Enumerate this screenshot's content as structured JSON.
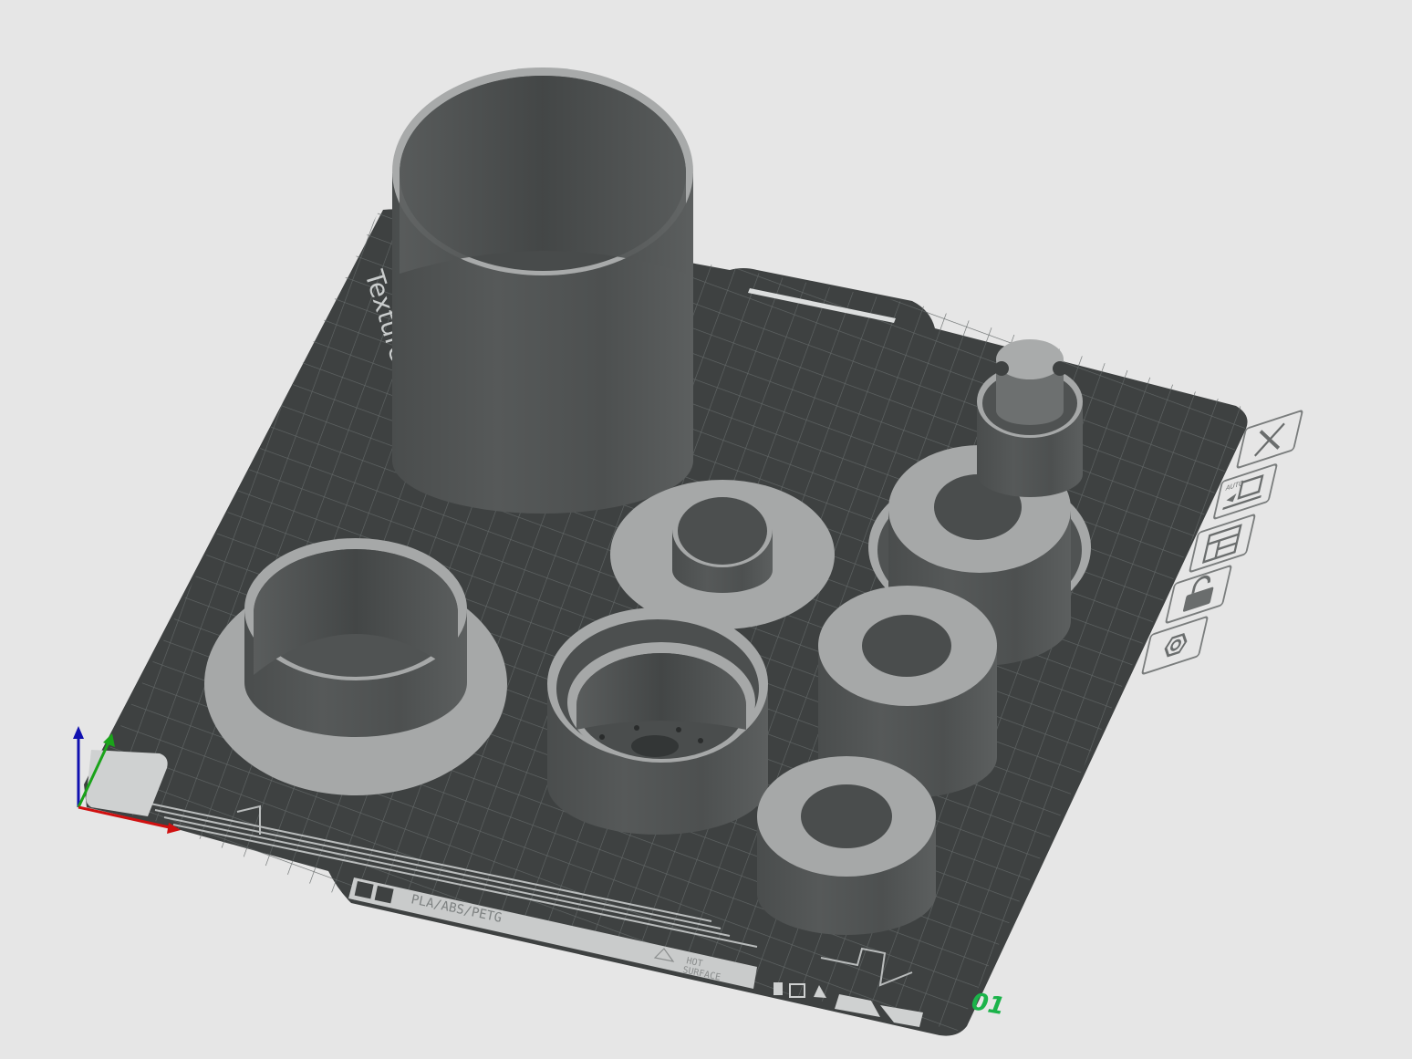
{
  "plate": {
    "name_label": "Textured PEI Plate",
    "material_label": "PLA/ABS/PETG",
    "warning_label_line1": "HOT",
    "warning_label_line2": "SURFACE",
    "plate_number": "01"
  },
  "plate_toolbar": [
    {
      "id": "close",
      "icon": "close-icon"
    },
    {
      "id": "auto-orient",
      "icon": "auto-orient-icon",
      "label": "AUTO"
    },
    {
      "id": "arrange",
      "icon": "arrange-icon"
    },
    {
      "id": "lock",
      "icon": "lock-icon"
    },
    {
      "id": "settings",
      "icon": "plate-settings-icon"
    }
  ],
  "axes": {
    "x_color": "#d01010",
    "y_color": "#1aa31a",
    "z_color": "#1010b0"
  },
  "colors": {
    "background": "#e6e6e6",
    "plate": "#3d4040",
    "grid": "#5e6363",
    "model_light": "#a7a9a9",
    "model_dark": "#505353",
    "plate_number": "#1bb34a"
  }
}
